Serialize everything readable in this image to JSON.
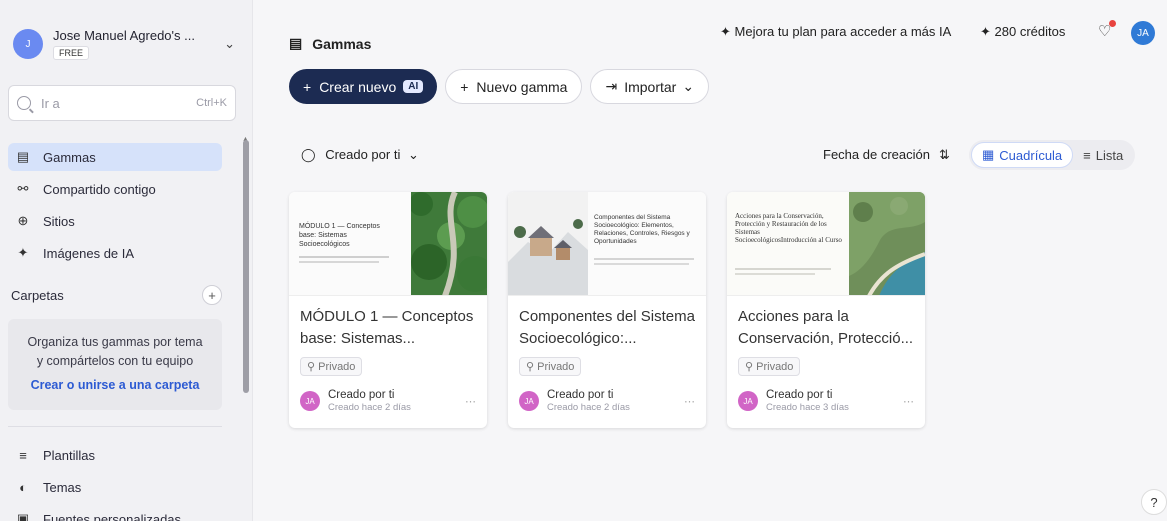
{
  "user": {
    "initials": "J",
    "name": "Jose Manuel Agredo's ...",
    "plan": "FREE"
  },
  "search": {
    "placeholder": "Ir a",
    "shortcut": "Ctrl+K"
  },
  "nav": [
    {
      "label": "Gammas",
      "icon": "gammas-icon",
      "active": true
    },
    {
      "label": "Compartido contigo",
      "icon": "shared-users-icon"
    },
    {
      "label": "Sitios",
      "icon": "globe-icon"
    },
    {
      "label": "Imágenes de IA",
      "icon": "sparkle-icon"
    }
  ],
  "folders": {
    "heading": "Carpetas",
    "empty_text_1": "Organiza tus gammas por tema",
    "empty_text_2": "y compártelos con tu equipo",
    "create_link": "Crear o unirse a una carpeta"
  },
  "nav_bottom": [
    {
      "label": "Plantillas",
      "icon": "templates-icon"
    },
    {
      "label": "Temas",
      "icon": "palette-icon"
    },
    {
      "label": "Fuentes personalizadas",
      "icon": "font-icon"
    }
  ],
  "header": {
    "title": "Gammas",
    "upgrade": "Mejora tu plan para acceder a más IA",
    "credits": "280 créditos",
    "avatar": "JA"
  },
  "actions": {
    "create_new": "Crear nuevo",
    "ai_badge": "AI",
    "new_gamma": "Nuevo gamma",
    "import": "Importar"
  },
  "filters": {
    "created_by": "Creado por ti",
    "sort_label": "Fecha de creación",
    "view_grid": "Cuadrícula",
    "view_list": "Lista"
  },
  "cards": [
    {
      "title": "MÓDULO 1 — Conceptos base: Sistemas...",
      "thumb_title": "MÓDULO 1 — Conceptos base: Sistemas Socioecológicos",
      "privacy": "Privado",
      "by": "Creado por ti",
      "when": "Creado hace 2 días",
      "initials": "JA"
    },
    {
      "title": "Componentes del Sistema Socioecológico:...",
      "thumb_title": "Componentes del Sistema Socioecológico: Elementos, Relaciones, Controles, Riesgos y Oportunidades",
      "privacy": "Privado",
      "by": "Creado por ti",
      "when": "Creado hace 2 días",
      "initials": "JA"
    },
    {
      "title": "Acciones para la Conservación, Protecció...",
      "thumb_title": "Acciones para la Conservación, Protección y Restauración de los Sistemas SocioecológicosIntroducción al Curso",
      "privacy": "Privado",
      "by": "Creado por ti",
      "when": "Creado hace 3 días",
      "initials": "JA"
    }
  ],
  "help": "?"
}
